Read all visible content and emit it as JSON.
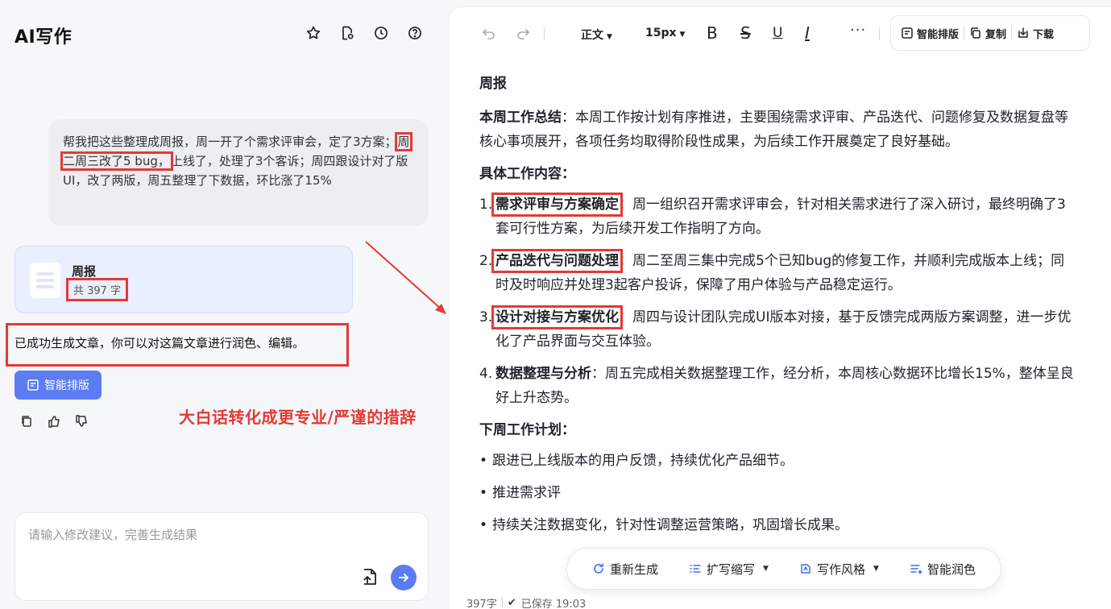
{
  "app": {
    "title": "AI写作"
  },
  "left_tools": [
    "star-icon",
    "document-settings-icon",
    "history-icon",
    "help-icon"
  ],
  "chat": {
    "user_message_parts": {
      "before": "帮我把这些整理成周报，周一开了个需求评审会，定了3方案；",
      "highlighted": "周二周三改了5 bug，",
      "after": "上线了，处理了3个客诉；周四跟设计对了版UI，改了两版，周五整理了下数据，环比涨了15%"
    },
    "doc_card": {
      "title": "周报",
      "count": "共 397 字"
    },
    "assistant_message": "已成功生成文章，你可以对这篇文章进行润色、编辑。",
    "smart_layout_button": "智能排版",
    "feedback_icons": [
      "copy-icon",
      "thumbs-up-icon",
      "thumbs-down-icon"
    ]
  },
  "annotation": {
    "text": "大白话转化成更专业/严谨的措辞",
    "color": "#e53935"
  },
  "input": {
    "placeholder": "请输入修改建议，完善生成结果"
  },
  "toolbar": {
    "style_select": "正文",
    "size_select": "15px",
    "bold": "B",
    "strike": "S",
    "underline": "U",
    "italic": "I",
    "more": "···",
    "smart_layout": "智能排版",
    "copy": "复制",
    "download": "下载"
  },
  "document": {
    "title": "周报",
    "summary_label": "本周工作总结",
    "summary_text": "：本周工作按计划有序推进，主要围绕需求评审、产品迭代、问题修复及数据复盘等核心事项展开，各项任务均取得阶段性成果，为后续工作开展奠定了良好基础。",
    "details_label": "具体工作内容：",
    "items": [
      {
        "num": "1.",
        "term": "需求评审与方案确定",
        "text": "：周一组织召开需求评审会，针对相关需求进行了深入研讨，最终明确了3套可行性方案，为后续开发工作指明了方向。"
      },
      {
        "num": "2.",
        "term": "产品迭代与问题处理",
        "text": "：周二至周三集中完成5个已知bug的修复工作，并顺利完成版本上线；同时及时响应并处理3起客户投诉，保障了用户体验与产品稳定运行。"
      },
      {
        "num": "3.",
        "term": "设计对接与方案优化",
        "text": "：周四与设计团队完成UI版本对接，基于反馈完成两版方案调整，进一步优化了产品界面与交互体验。"
      },
      {
        "num": "4.",
        "term": "数据整理与分析",
        "text": "：周五完成相关数据整理工作，经分析，本周核心数据环比增长15%，整体呈良好上升态势。"
      }
    ],
    "next_label": "下周工作计划：",
    "next_items": [
      "跟进已上线版本的用户反馈，持续优化产品细节。",
      "推进需求评",
      "持续关注数据变化，针对性调整运营策略，巩固增长成果。"
    ]
  },
  "float_bar": {
    "regenerate": "重新生成",
    "expand": "扩写缩写",
    "style": "写作风格",
    "polish": "智能润色"
  },
  "status": {
    "words": "397字",
    "saved": "已保存 19:03"
  },
  "colors": {
    "accent": "#5b7cf2",
    "annotation": "#e53935"
  }
}
